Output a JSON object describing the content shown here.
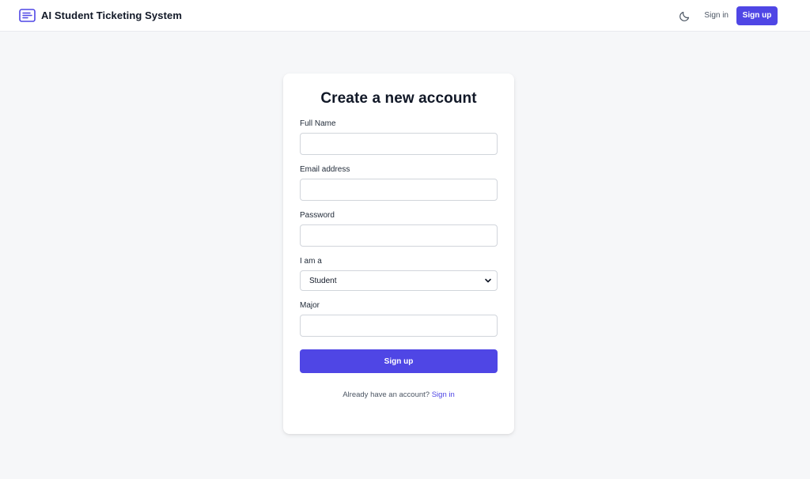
{
  "header": {
    "app_title": "AI Student Ticketing System",
    "logo_icon": "list-box-icon",
    "theme_icon": "moon-icon",
    "signin_label": "Sign in",
    "signup_label": "Sign up",
    "accent_color": "#4f46e5"
  },
  "form": {
    "title": "Create a new account",
    "fields": {
      "full_name": {
        "label": "Full Name",
        "value": "",
        "placeholder": ""
      },
      "email": {
        "label": "Email address",
        "value": "",
        "placeholder": ""
      },
      "password": {
        "label": "Password",
        "value": "",
        "placeholder": ""
      },
      "role": {
        "label": "I am a",
        "selected": "Student"
      },
      "major": {
        "label": "Major",
        "value": "",
        "placeholder": ""
      }
    },
    "submit_label": "Sign up",
    "footer_prompt": "Already have an account?",
    "footer_link": "Sign in"
  }
}
